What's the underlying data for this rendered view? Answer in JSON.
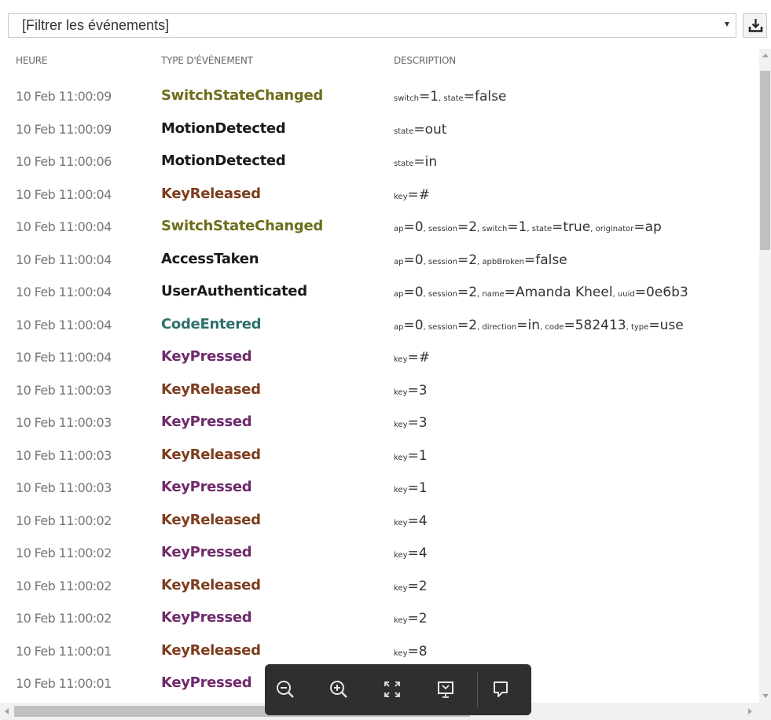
{
  "filter": {
    "value": "[Filtrer les événements]"
  },
  "columns": {
    "time": "HEURE",
    "type": "TYPE D'ÉVÉNEMENT",
    "description": "DESCRIPTION"
  },
  "colors": {
    "switch": "#6d6e1c",
    "motion": "#1a1a1a",
    "access": "#1a1a1a",
    "user": "#1a1a1a",
    "key_released": "#7d3d1e",
    "key_pressed": "#6e2a6b",
    "code": "#2f6f6a"
  },
  "rows": [
    {
      "time": "10 Feb 11:00:09",
      "type": "SwitchStateChanged",
      "color": "#6d6e1c",
      "desc": [
        {
          "k": "switch",
          "v": "1"
        },
        {
          "k": "state",
          "v": "false"
        }
      ]
    },
    {
      "time": "10 Feb 11:00:09",
      "type": "MotionDetected",
      "color": "#1a1a1a",
      "desc": [
        {
          "k": "state",
          "v": "out"
        }
      ]
    },
    {
      "time": "10 Feb 11:00:06",
      "type": "MotionDetected",
      "color": "#1a1a1a",
      "desc": [
        {
          "k": "state",
          "v": "in"
        }
      ]
    },
    {
      "time": "10 Feb 11:00:04",
      "type": "KeyReleased",
      "color": "#7d3d1e",
      "desc": [
        {
          "k": "key",
          "v": "#"
        }
      ]
    },
    {
      "time": "10 Feb 11:00:04",
      "type": "SwitchStateChanged",
      "color": "#6d6e1c",
      "desc": [
        {
          "k": "ap",
          "v": "0"
        },
        {
          "k": "session",
          "v": "2"
        },
        {
          "k": "switch",
          "v": "1"
        },
        {
          "k": "state",
          "v": "true"
        },
        {
          "k": "originator",
          "v": "ap"
        }
      ]
    },
    {
      "time": "10 Feb 11:00:04",
      "type": "AccessTaken",
      "color": "#1a1a1a",
      "desc": [
        {
          "k": "ap",
          "v": "0"
        },
        {
          "k": "session",
          "v": "2"
        },
        {
          "k": "apbBroken",
          "v": "false"
        }
      ]
    },
    {
      "time": "10 Feb 11:00:04",
      "type": "UserAuthenticated",
      "color": "#1a1a1a",
      "desc": [
        {
          "k": "ap",
          "v": "0"
        },
        {
          "k": "session",
          "v": "2"
        },
        {
          "k": "name",
          "v": "Amanda Kheel"
        },
        {
          "k": "uuid",
          "v": "0e6b3"
        }
      ]
    },
    {
      "time": "10 Feb 11:00:04",
      "type": "CodeEntered",
      "color": "#2f6f6a",
      "desc": [
        {
          "k": "ap",
          "v": "0"
        },
        {
          "k": "session",
          "v": "2"
        },
        {
          "k": "direction",
          "v": "in"
        },
        {
          "k": "code",
          "v": "582413"
        },
        {
          "k": "type",
          "v": "use"
        }
      ]
    },
    {
      "time": "10 Feb 11:00:04",
      "type": "KeyPressed",
      "color": "#6e2a6b",
      "desc": [
        {
          "k": "key",
          "v": "#"
        }
      ]
    },
    {
      "time": "10 Feb 11:00:03",
      "type": "KeyReleased",
      "color": "#7d3d1e",
      "desc": [
        {
          "k": "key",
          "v": "3"
        }
      ]
    },
    {
      "time": "10 Feb 11:00:03",
      "type": "KeyPressed",
      "color": "#6e2a6b",
      "desc": [
        {
          "k": "key",
          "v": "3"
        }
      ]
    },
    {
      "time": "10 Feb 11:00:03",
      "type": "KeyReleased",
      "color": "#7d3d1e",
      "desc": [
        {
          "k": "key",
          "v": "1"
        }
      ]
    },
    {
      "time": "10 Feb 11:00:03",
      "type": "KeyPressed",
      "color": "#6e2a6b",
      "desc": [
        {
          "k": "key",
          "v": "1"
        }
      ]
    },
    {
      "time": "10 Feb 11:00:02",
      "type": "KeyReleased",
      "color": "#7d3d1e",
      "desc": [
        {
          "k": "key",
          "v": "4"
        }
      ]
    },
    {
      "time": "10 Feb 11:00:02",
      "type": "KeyPressed",
      "color": "#6e2a6b",
      "desc": [
        {
          "k": "key",
          "v": "4"
        }
      ]
    },
    {
      "time": "10 Feb 11:00:02",
      "type": "KeyReleased",
      "color": "#7d3d1e",
      "desc": [
        {
          "k": "key",
          "v": "2"
        }
      ]
    },
    {
      "time": "10 Feb 11:00:02",
      "type": "KeyPressed",
      "color": "#6e2a6b",
      "desc": [
        {
          "k": "key",
          "v": "2"
        }
      ]
    },
    {
      "time": "10 Feb 11:00:01",
      "type": "KeyReleased",
      "color": "#7d3d1e",
      "desc": [
        {
          "k": "key",
          "v": "8"
        }
      ]
    },
    {
      "time": "10 Feb 11:00:01",
      "type": "KeyPressed",
      "color": "#6e2a6b",
      "desc": []
    }
  ],
  "toolbar": {
    "icons": [
      "zoom-out-icon",
      "zoom-in-icon",
      "fullscreen-icon",
      "presentation-icon",
      "comment-icon"
    ]
  },
  "download_icon": "download-icon"
}
